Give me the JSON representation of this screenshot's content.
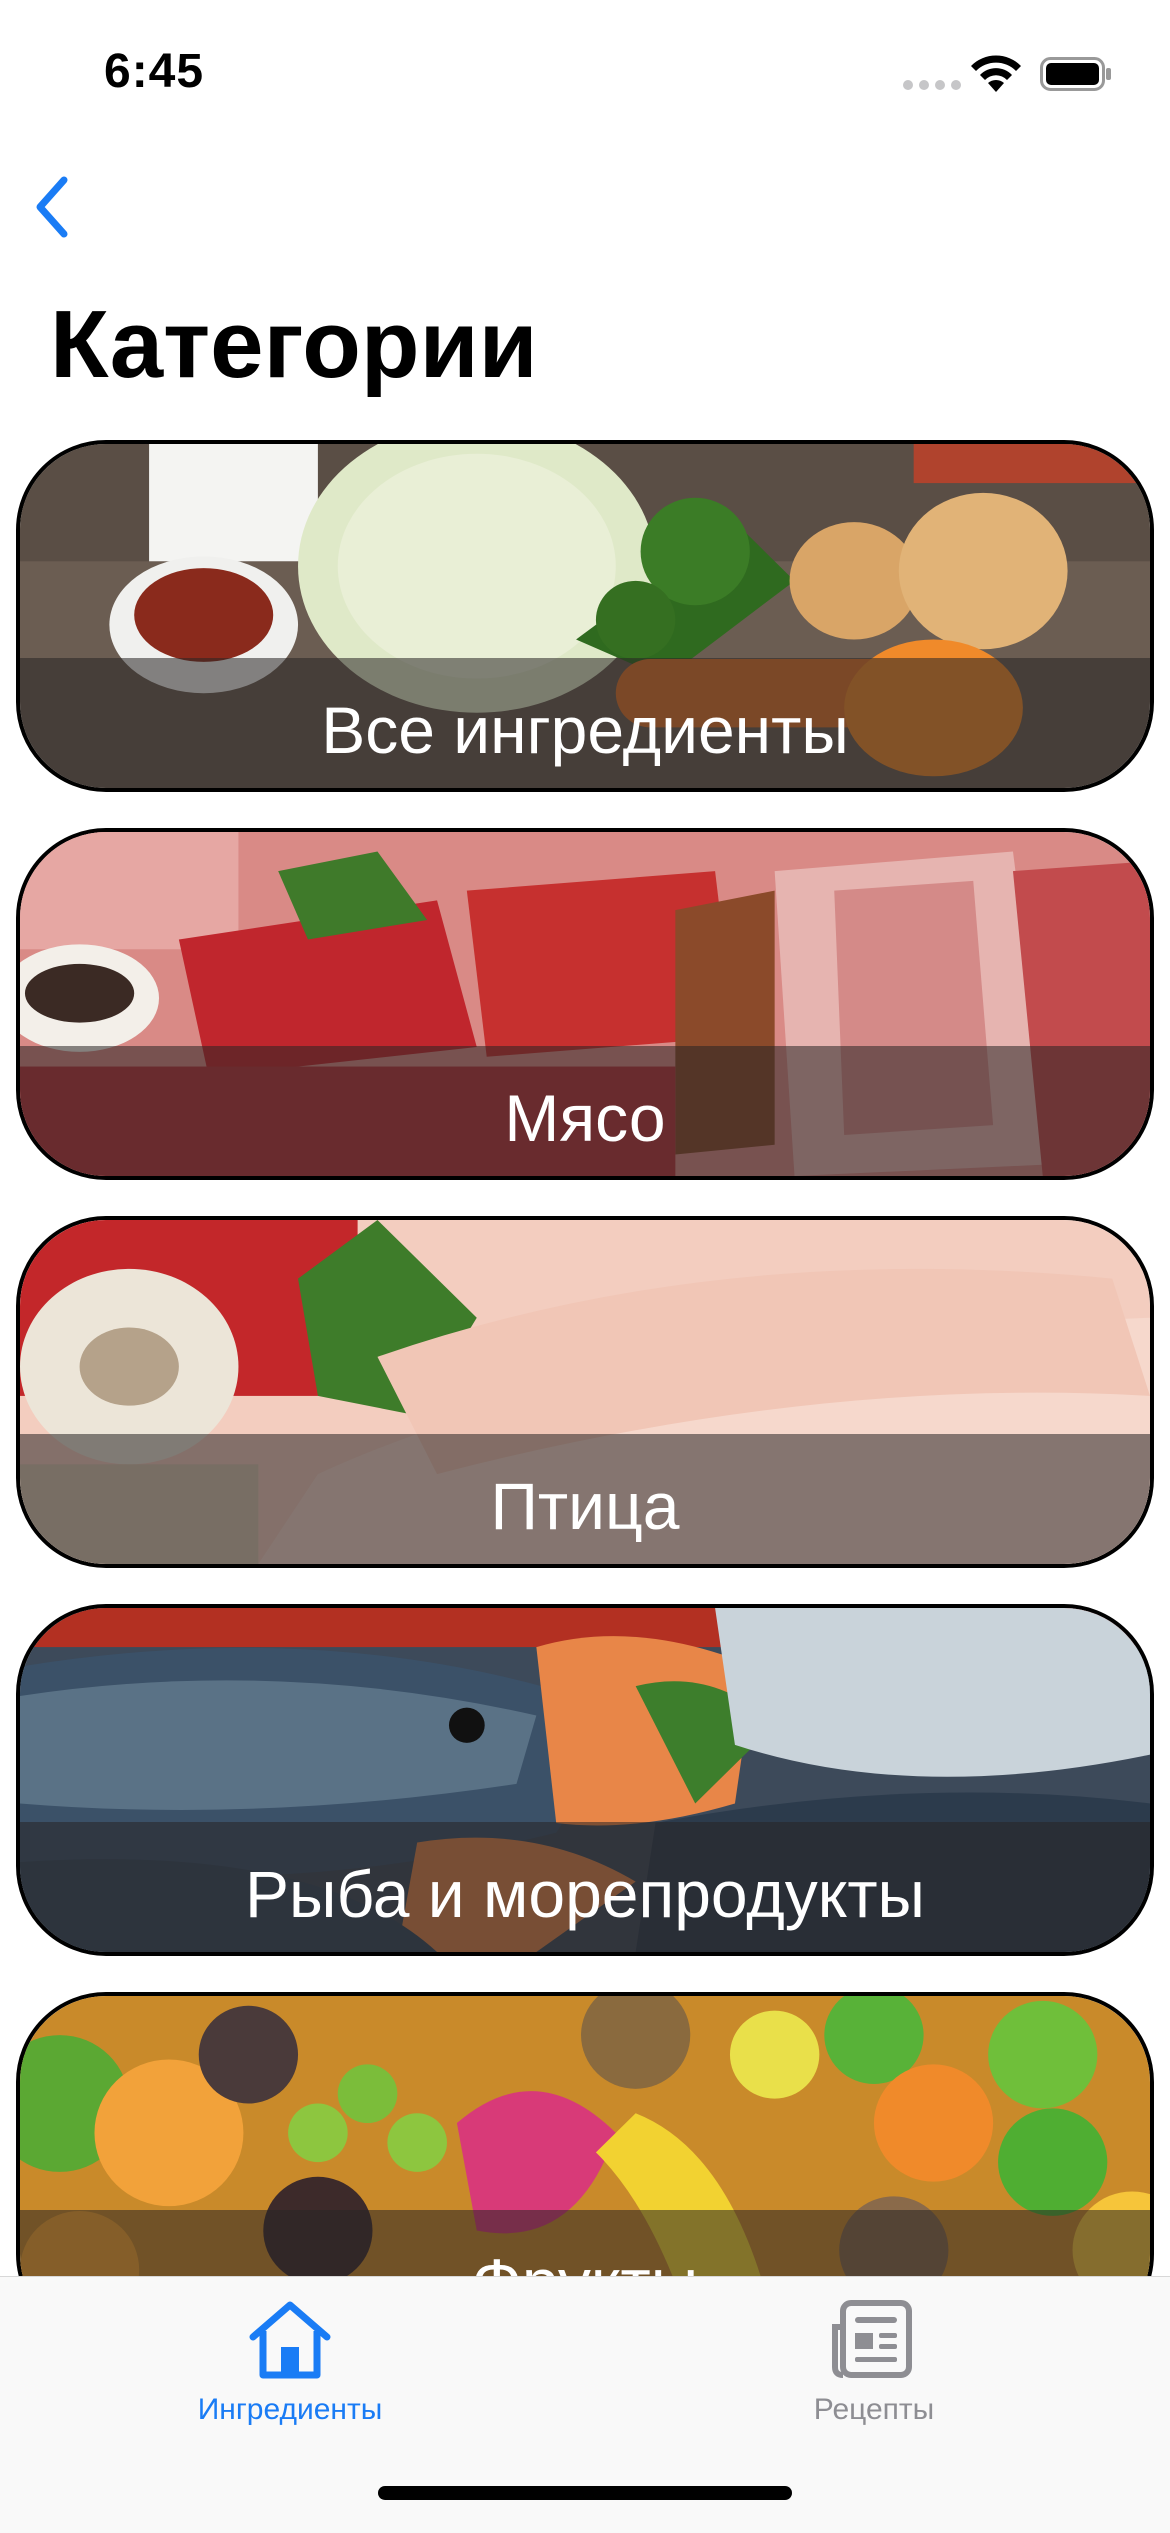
{
  "status_bar": {
    "time": "6:45"
  },
  "nav": {
    "title": "Категории"
  },
  "categories": [
    {
      "label": "Все ингредиенты",
      "image": "vegetables-photo"
    },
    {
      "label": "Мясо",
      "image": "raw-meat-photo"
    },
    {
      "label": "Птица",
      "image": "chicken-breast-photo"
    },
    {
      "label": "Рыба и морепродукты",
      "image": "fish-seafood-photo"
    },
    {
      "label": "Фрукты",
      "image": "fruits-photo"
    }
  ],
  "tab_bar": {
    "tabs": [
      {
        "label": "Ингредиенты",
        "icon": "house-icon",
        "active": true
      },
      {
        "label": "Рецепты",
        "icon": "newspaper-icon",
        "active": false
      }
    ]
  },
  "colors": {
    "accent": "#1a7cf5",
    "inactive": "#8e8e93",
    "label_bar": "#282424"
  }
}
